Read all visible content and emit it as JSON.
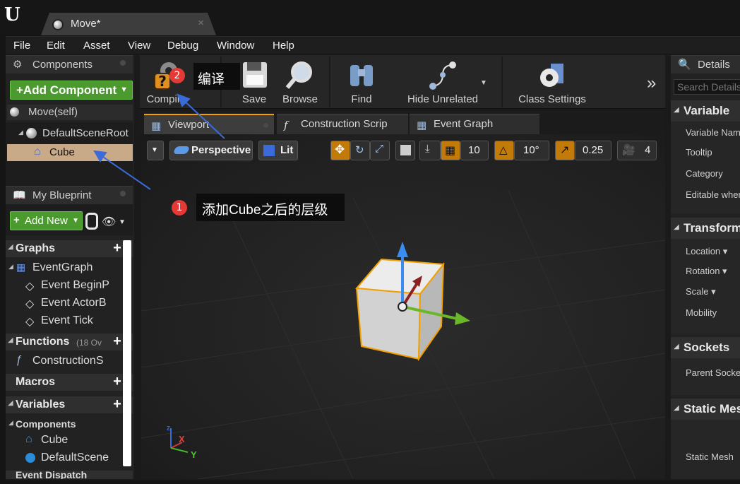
{
  "window": {
    "tab_title": "Move*"
  },
  "menu": [
    "File",
    "Edit",
    "Asset",
    "View",
    "Debug",
    "Window",
    "Help"
  ],
  "components_panel": {
    "title": "Components",
    "add_button": "+Add Component",
    "self_label": "Move(self)",
    "tree": [
      "DefaultSceneRoot",
      "Cube"
    ]
  },
  "my_blueprint": {
    "title": "My Blueprint",
    "add_new": "Add New",
    "graphs": {
      "label": "Graphs",
      "event_graph": "EventGraph",
      "events": [
        "Event BeginP",
        "Event ActorB",
        "Event Tick"
      ]
    },
    "functions": {
      "label": "Functions",
      "count": "(18 Ov",
      "items": [
        "ConstructionS"
      ]
    },
    "macros": "Macros",
    "variables": "Variables",
    "components": {
      "label": "Components",
      "items": [
        "Cube",
        "DefaultScene"
      ]
    },
    "partial": "Event Dispatch"
  },
  "toolbar": {
    "compile": "Compile",
    "save": "Save",
    "browse": "Browse",
    "find": "Find",
    "hide_unrelated": "Hide Unrelated",
    "class_settings": "Class Settings"
  },
  "editor_tabs": [
    "Viewport",
    "Construction Scrip",
    "Event Graph"
  ],
  "viewport": {
    "perspective": "Perspective",
    "lit": "Lit",
    "grid_snap": "10",
    "rotation_snap": "10°",
    "scale_snap": "0.25",
    "camera_speed": "4",
    "axis_x": "X",
    "axis_y": "Y",
    "axis_z": "Z"
  },
  "details": {
    "title": "Details",
    "search_placeholder": "Search Details",
    "variable": {
      "label": "Variable",
      "props": [
        "Variable Name",
        "Tooltip",
        "Category",
        "Editable when"
      ]
    },
    "transform": {
      "label": "Transform",
      "props": [
        "Location",
        "Rotation",
        "Scale",
        "Mobility"
      ]
    },
    "sockets": {
      "label": "Sockets",
      "props": [
        "Parent Socket"
      ]
    },
    "static_mesh": {
      "label": "Static Mes",
      "props": [
        "Static Mesh"
      ]
    }
  },
  "annotations": [
    {
      "badge": "1",
      "text": "添加Cube之后的层级"
    },
    {
      "badge": "2",
      "text": "编译"
    }
  ],
  "colors": {
    "accent_orange": "#f0a000",
    "green_button": "#4a9a2e",
    "selection": "#c8aa88",
    "badge_red": "#e53935",
    "arrow_blue": "#3a6bd8"
  }
}
